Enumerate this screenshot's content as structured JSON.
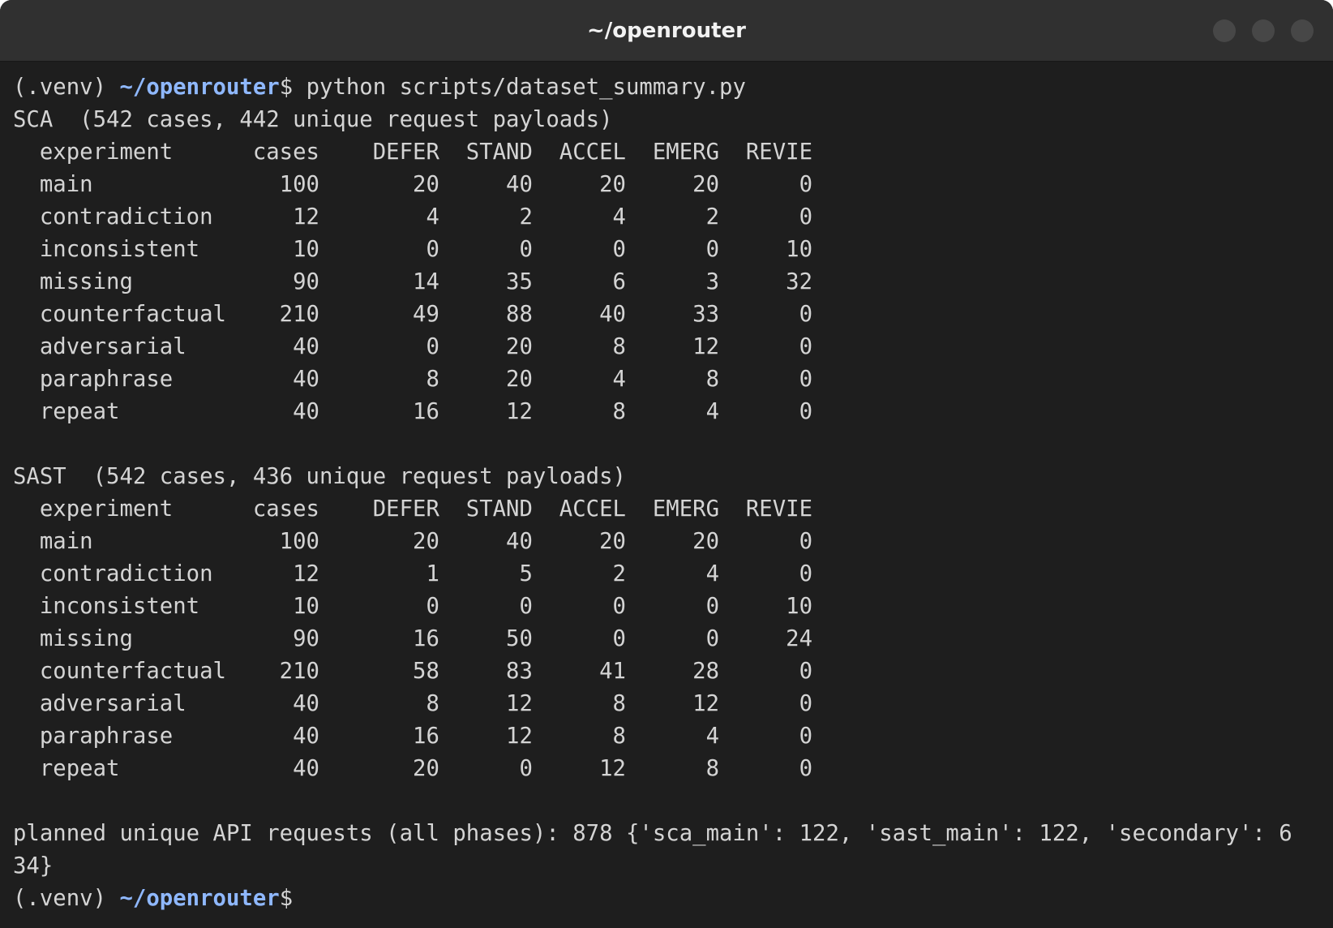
{
  "window": {
    "title": "~/openrouter"
  },
  "prompt": {
    "venv": "(.venv) ",
    "path": "~/openrouter",
    "symbol": "$",
    "command": " python scripts/dataset_summary.py"
  },
  "output": {
    "sca_header": "SCA  (542 cases, 442 unique request payloads)",
    "sca_col_header": "  experiment      cases    DEFER  STAND  ACCEL  EMERG  REVIE",
    "sca_rows": [
      "  main              100       20     40     20     20      0",
      "  contradiction      12        4      2      4      2      0",
      "  inconsistent       10        0      0      0      0     10",
      "  missing            90       14     35      6      3     32",
      "  counterfactual    210       49     88     40     33      0",
      "  adversarial        40        0     20      8     12      0",
      "  paraphrase         40        8     20      4      8      0",
      "  repeat             40       16     12      8      4      0"
    ],
    "sast_header": "SAST  (542 cases, 436 unique request payloads)",
    "sast_col_header": "  experiment      cases    DEFER  STAND  ACCEL  EMERG  REVIE",
    "sast_rows": [
      "  main              100       20     40     20     20      0",
      "  contradiction      12        1      5      2      4      0",
      "  inconsistent       10        0      0      0      0     10",
      "  missing            90       16     50      0      0     24",
      "  counterfactual    210       58     83     41     28      0",
      "  adversarial        40        8     12      8     12      0",
      "  paraphrase         40       16     12      8      4      0",
      "  repeat             40       20      0     12      8      0"
    ],
    "planned_line_1": "planned unique API requests (all phases): 878 {'sca_main': 122, 'sast_main': 122, 'secondary': 6",
    "planned_line_2": "34}"
  }
}
